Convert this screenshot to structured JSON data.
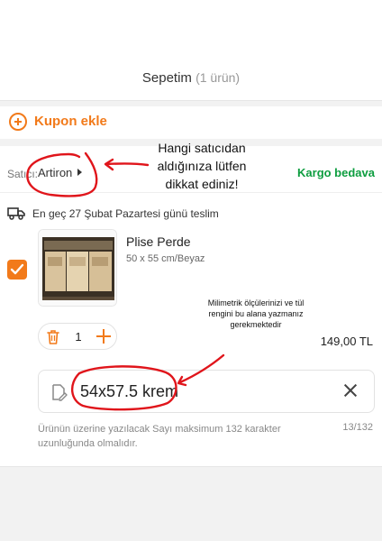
{
  "header": {
    "title": "Sepetim",
    "count": "(1 ürün)"
  },
  "coupon": {
    "label": "Kupon ekle"
  },
  "seller": {
    "prefix": "Satıcı:",
    "name": "Artiron",
    "cargo": "Kargo bedava"
  },
  "annotations": {
    "seller_note": "Hangi satıcıdan aldığınıza lütfen dikkat ediniz!",
    "measure_note": "Milimetrik ölçülerinizi ve tül rengini bu alana yazmanız gerekmektedir"
  },
  "delivery": {
    "text": "En geç 27 Şubat Pazartesi günü teslim"
  },
  "product": {
    "name": "Plise Perde",
    "variant": "50 x 55 cm/Beyaz",
    "quantity": "1",
    "price": "149,00 TL",
    "selected": true
  },
  "note": {
    "value": "54x57.5 krem",
    "hint": "Ürünün üzerine yazılacak Sayı maksimum 132 karakter uzunluğunda olmalıdır.",
    "counter": "13/132"
  },
  "colors": {
    "accent": "#f27a1a",
    "success": "#0d9d3f",
    "annotation": "#e0151b"
  },
  "icons": [
    "coupon-plus-icon",
    "caret-right-icon",
    "truck-icon",
    "checkbox-icon",
    "trash-icon",
    "plus-icon",
    "note-icon",
    "close-icon"
  ]
}
